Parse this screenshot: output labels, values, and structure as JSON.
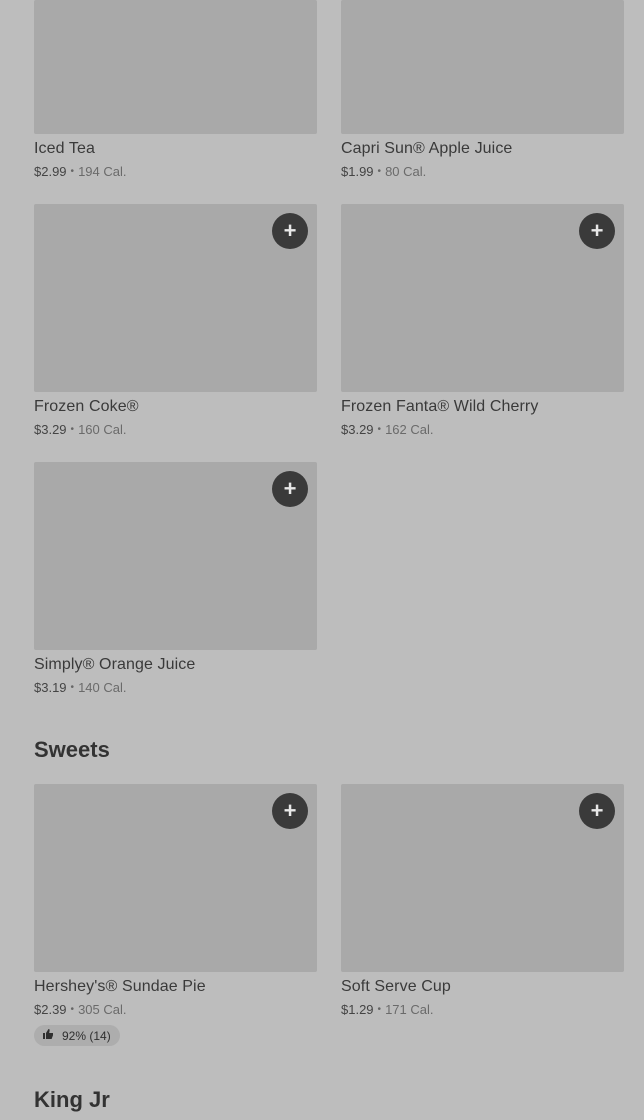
{
  "beverages": [
    {
      "name": "Iced Tea",
      "price": "$2.99",
      "cal": "194 Cal."
    },
    {
      "name": "Capri Sun® Apple Juice",
      "price": "$1.99",
      "cal": "80 Cal."
    },
    {
      "name": "Frozen Coke®",
      "price": "$3.29",
      "cal": "160 Cal.",
      "add_icon": "+"
    },
    {
      "name": "Frozen Fanta® Wild Cherry",
      "price": "$3.29",
      "cal": "162 Cal.",
      "add_icon": "+"
    },
    {
      "name": "Simply® Orange Juice",
      "price": "$3.19",
      "cal": "140 Cal.",
      "add_icon": "+"
    }
  ],
  "sweets": {
    "title": "Sweets",
    "items": [
      {
        "name": "Hershey's® Sundae Pie",
        "price": "$2.39",
        "cal": "305 Cal.",
        "add_icon": "+",
        "rating": "92% (14)"
      },
      {
        "name": "Soft Serve Cup",
        "price": "$1.29",
        "cal": "171 Cal.",
        "add_icon": "+"
      }
    ]
  },
  "next_section": {
    "title": "King Jr"
  },
  "separator": "•",
  "icons": {
    "add": "plus-icon",
    "thumb": "thumbs-up-icon"
  },
  "colors": {
    "background": "#bdbdbd",
    "image_placeholder": "#a9a9a9",
    "add_button": "#3a3a3a"
  }
}
